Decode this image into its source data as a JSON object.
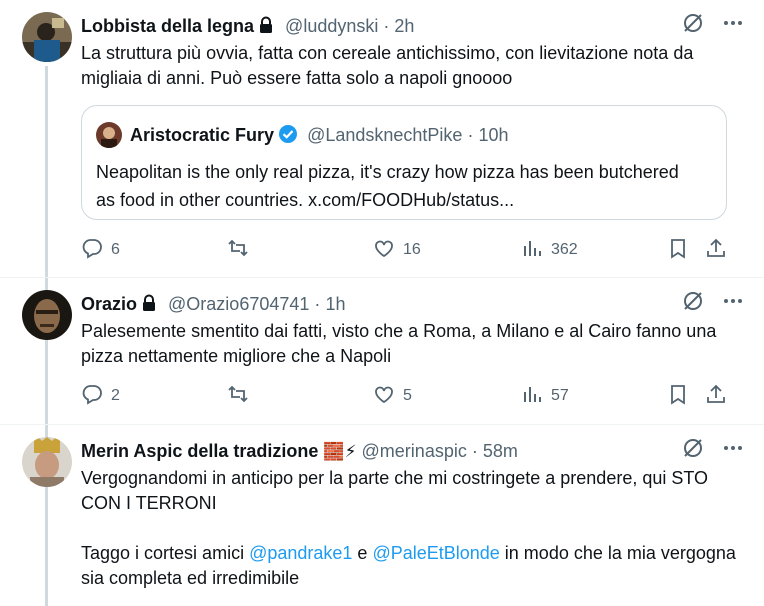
{
  "tweets": [
    {
      "name": "Lobbista della legna",
      "handle": "@luddynski",
      "dot": "·",
      "time": "2h",
      "text": "La struttura più ovvia, fatta con cereale antichissimo, con lievitazione nota da migliaia di anni. Può essere fatta solo a napoli gnoooo",
      "quote": {
        "name": "Aristocratic Fury",
        "handle": "@LandsknechtPike",
        "dot": "·",
        "time": "10h",
        "text": "Neapolitan is the only real pizza, it's crazy how pizza has been butchered as food in other countries. x.com/FOODHub/status..."
      },
      "replies": "6",
      "retweets": "",
      "likes": "16",
      "views": "362"
    },
    {
      "name": "Orazio",
      "handle": "@Orazio6704741",
      "dot": "·",
      "time": "1h",
      "text": "Palesemente smentito dai fatti, visto che a Roma, a Milano e al Cairo fanno una pizza nettamente migliore che a Napoli",
      "replies": "2",
      "retweets": "",
      "likes": "5",
      "views": "57"
    },
    {
      "name": "Merin Aspic della tradizione",
      "emoji": "🧱⚡",
      "handle": "@merinaspic",
      "dot": "·",
      "time": "58m",
      "text_line1": "Vergognandomi in anticipo per la parte che mi costringete a prendere, qui STO CON I TERRONI",
      "text_prefix": "Taggo i cortesi amici ",
      "mention1": "@pandrake1",
      "text_and": " e ",
      "mention2": "@PaleEtBlonde",
      "text_suffix": " in modo che la mia vergogna sia completa ed irredimibile"
    }
  ],
  "icons": {
    "lock": "lock-icon",
    "verified": "verified-badge-icon",
    "grok": "grok-icon",
    "more": "more-icon",
    "reply": "reply-icon",
    "retweet": "retweet-icon",
    "like": "like-icon",
    "views": "views-icon",
    "bookmark": "bookmark-icon",
    "share": "share-icon"
  },
  "colors": {
    "accent": "#1d9bf0",
    "muted": "#536471",
    "border": "#cfd9de",
    "verified": "#1d9bf0"
  }
}
